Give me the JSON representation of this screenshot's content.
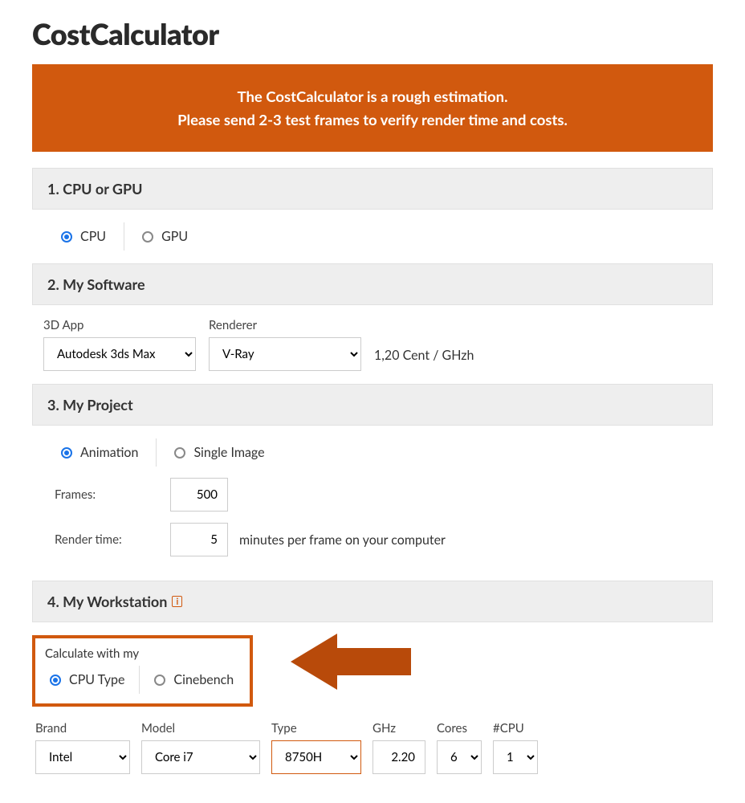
{
  "title": "CostCalculator",
  "banner_line1": "The CostCalculator is a rough estimation.",
  "banner_line2": "Please send 2-3 test frames to verify render time and costs.",
  "section1": {
    "header": "1. CPU or GPU",
    "cpu_label": "CPU",
    "gpu_label": "GPU"
  },
  "section2": {
    "header": "2. My Software",
    "app_label": "3D App",
    "app_value": "Autodesk 3ds Max",
    "renderer_label": "Renderer",
    "renderer_value": "V-Ray",
    "rate": "1,20 Cent / GHzh"
  },
  "section3": {
    "header": "3. My Project",
    "animation_label": "Animation",
    "single_label": "Single Image",
    "frames_label": "Frames:",
    "frames_value": "500",
    "render_label": "Render time:",
    "render_value": "5",
    "render_suffix": "minutes per frame on your computer"
  },
  "section4": {
    "header": "4. My Workstation",
    "calc_label": "Calculate with my",
    "cputype_label": "CPU Type",
    "cinebench_label": "Cinebench",
    "brand_label": "Brand",
    "brand_value": "Intel",
    "model_label": "Model",
    "model_value": "Core i7",
    "type_label": "Type",
    "type_value": "8750H",
    "ghz_label": "GHz",
    "ghz_value": "2.20",
    "cores_label": "Cores",
    "cores_value": "6",
    "cpucount_label": "#CPU",
    "cpucount_value": "1"
  }
}
